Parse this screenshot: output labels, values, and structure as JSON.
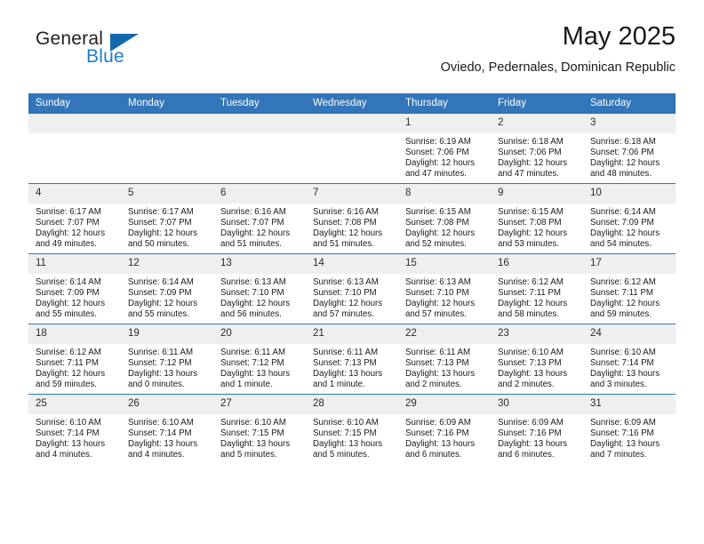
{
  "brand": {
    "name_part1": "General",
    "name_part2": "Blue",
    "logo_icon": "triangle-logo-icon"
  },
  "header": {
    "month_title": "May 2025",
    "location": "Oviedo, Pedernales, Dominican Republic"
  },
  "colors": {
    "header_blue": "#3275b8",
    "brand_blue": "#1b7fc4",
    "daynum_background": "#efefef",
    "text": "#1a1a1a"
  },
  "weekdays": [
    "Sunday",
    "Monday",
    "Tuesday",
    "Wednesday",
    "Thursday",
    "Friday",
    "Saturday"
  ],
  "weeks": [
    [
      {
        "day": "",
        "blank": true,
        "sunrise": "",
        "sunset": "",
        "daylight_line1": "",
        "daylight_line2": ""
      },
      {
        "day": "",
        "blank": true,
        "sunrise": "",
        "sunset": "",
        "daylight_line1": "",
        "daylight_line2": ""
      },
      {
        "day": "",
        "blank": true,
        "sunrise": "",
        "sunset": "",
        "daylight_line1": "",
        "daylight_line2": ""
      },
      {
        "day": "",
        "blank": true,
        "sunrise": "",
        "sunset": "",
        "daylight_line1": "",
        "daylight_line2": ""
      },
      {
        "day": "1",
        "blank": false,
        "sunrise": "Sunrise: 6:19 AM",
        "sunset": "Sunset: 7:06 PM",
        "daylight_line1": "Daylight: 12 hours",
        "daylight_line2": "and 47 minutes."
      },
      {
        "day": "2",
        "blank": false,
        "sunrise": "Sunrise: 6:18 AM",
        "sunset": "Sunset: 7:06 PM",
        "daylight_line1": "Daylight: 12 hours",
        "daylight_line2": "and 47 minutes."
      },
      {
        "day": "3",
        "blank": false,
        "sunrise": "Sunrise: 6:18 AM",
        "sunset": "Sunset: 7:06 PM",
        "daylight_line1": "Daylight: 12 hours",
        "daylight_line2": "and 48 minutes."
      }
    ],
    [
      {
        "day": "4",
        "blank": false,
        "sunrise": "Sunrise: 6:17 AM",
        "sunset": "Sunset: 7:07 PM",
        "daylight_line1": "Daylight: 12 hours",
        "daylight_line2": "and 49 minutes."
      },
      {
        "day": "5",
        "blank": false,
        "sunrise": "Sunrise: 6:17 AM",
        "sunset": "Sunset: 7:07 PM",
        "daylight_line1": "Daylight: 12 hours",
        "daylight_line2": "and 50 minutes."
      },
      {
        "day": "6",
        "blank": false,
        "sunrise": "Sunrise: 6:16 AM",
        "sunset": "Sunset: 7:07 PM",
        "daylight_line1": "Daylight: 12 hours",
        "daylight_line2": "and 51 minutes."
      },
      {
        "day": "7",
        "blank": false,
        "sunrise": "Sunrise: 6:16 AM",
        "sunset": "Sunset: 7:08 PM",
        "daylight_line1": "Daylight: 12 hours",
        "daylight_line2": "and 51 minutes."
      },
      {
        "day": "8",
        "blank": false,
        "sunrise": "Sunrise: 6:15 AM",
        "sunset": "Sunset: 7:08 PM",
        "daylight_line1": "Daylight: 12 hours",
        "daylight_line2": "and 52 minutes."
      },
      {
        "day": "9",
        "blank": false,
        "sunrise": "Sunrise: 6:15 AM",
        "sunset": "Sunset: 7:08 PM",
        "daylight_line1": "Daylight: 12 hours",
        "daylight_line2": "and 53 minutes."
      },
      {
        "day": "10",
        "blank": false,
        "sunrise": "Sunrise: 6:14 AM",
        "sunset": "Sunset: 7:09 PM",
        "daylight_line1": "Daylight: 12 hours",
        "daylight_line2": "and 54 minutes."
      }
    ],
    [
      {
        "day": "11",
        "blank": false,
        "sunrise": "Sunrise: 6:14 AM",
        "sunset": "Sunset: 7:09 PM",
        "daylight_line1": "Daylight: 12 hours",
        "daylight_line2": "and 55 minutes."
      },
      {
        "day": "12",
        "blank": false,
        "sunrise": "Sunrise: 6:14 AM",
        "sunset": "Sunset: 7:09 PM",
        "daylight_line1": "Daylight: 12 hours",
        "daylight_line2": "and 55 minutes."
      },
      {
        "day": "13",
        "blank": false,
        "sunrise": "Sunrise: 6:13 AM",
        "sunset": "Sunset: 7:10 PM",
        "daylight_line1": "Daylight: 12 hours",
        "daylight_line2": "and 56 minutes."
      },
      {
        "day": "14",
        "blank": false,
        "sunrise": "Sunrise: 6:13 AM",
        "sunset": "Sunset: 7:10 PM",
        "daylight_line1": "Daylight: 12 hours",
        "daylight_line2": "and 57 minutes."
      },
      {
        "day": "15",
        "blank": false,
        "sunrise": "Sunrise: 6:13 AM",
        "sunset": "Sunset: 7:10 PM",
        "daylight_line1": "Daylight: 12 hours",
        "daylight_line2": "and 57 minutes."
      },
      {
        "day": "16",
        "blank": false,
        "sunrise": "Sunrise: 6:12 AM",
        "sunset": "Sunset: 7:11 PM",
        "daylight_line1": "Daylight: 12 hours",
        "daylight_line2": "and 58 minutes."
      },
      {
        "day": "17",
        "blank": false,
        "sunrise": "Sunrise: 6:12 AM",
        "sunset": "Sunset: 7:11 PM",
        "daylight_line1": "Daylight: 12 hours",
        "daylight_line2": "and 59 minutes."
      }
    ],
    [
      {
        "day": "18",
        "blank": false,
        "sunrise": "Sunrise: 6:12 AM",
        "sunset": "Sunset: 7:11 PM",
        "daylight_line1": "Daylight: 12 hours",
        "daylight_line2": "and 59 minutes."
      },
      {
        "day": "19",
        "blank": false,
        "sunrise": "Sunrise: 6:11 AM",
        "sunset": "Sunset: 7:12 PM",
        "daylight_line1": "Daylight: 13 hours",
        "daylight_line2": "and 0 minutes."
      },
      {
        "day": "20",
        "blank": false,
        "sunrise": "Sunrise: 6:11 AM",
        "sunset": "Sunset: 7:12 PM",
        "daylight_line1": "Daylight: 13 hours",
        "daylight_line2": "and 1 minute."
      },
      {
        "day": "21",
        "blank": false,
        "sunrise": "Sunrise: 6:11 AM",
        "sunset": "Sunset: 7:13 PM",
        "daylight_line1": "Daylight: 13 hours",
        "daylight_line2": "and 1 minute."
      },
      {
        "day": "22",
        "blank": false,
        "sunrise": "Sunrise: 6:11 AM",
        "sunset": "Sunset: 7:13 PM",
        "daylight_line1": "Daylight: 13 hours",
        "daylight_line2": "and 2 minutes."
      },
      {
        "day": "23",
        "blank": false,
        "sunrise": "Sunrise: 6:10 AM",
        "sunset": "Sunset: 7:13 PM",
        "daylight_line1": "Daylight: 13 hours",
        "daylight_line2": "and 2 minutes."
      },
      {
        "day": "24",
        "blank": false,
        "sunrise": "Sunrise: 6:10 AM",
        "sunset": "Sunset: 7:14 PM",
        "daylight_line1": "Daylight: 13 hours",
        "daylight_line2": "and 3 minutes."
      }
    ],
    [
      {
        "day": "25",
        "blank": false,
        "sunrise": "Sunrise: 6:10 AM",
        "sunset": "Sunset: 7:14 PM",
        "daylight_line1": "Daylight: 13 hours",
        "daylight_line2": "and 4 minutes."
      },
      {
        "day": "26",
        "blank": false,
        "sunrise": "Sunrise: 6:10 AM",
        "sunset": "Sunset: 7:14 PM",
        "daylight_line1": "Daylight: 13 hours",
        "daylight_line2": "and 4 minutes."
      },
      {
        "day": "27",
        "blank": false,
        "sunrise": "Sunrise: 6:10 AM",
        "sunset": "Sunset: 7:15 PM",
        "daylight_line1": "Daylight: 13 hours",
        "daylight_line2": "and 5 minutes."
      },
      {
        "day": "28",
        "blank": false,
        "sunrise": "Sunrise: 6:10 AM",
        "sunset": "Sunset: 7:15 PM",
        "daylight_line1": "Daylight: 13 hours",
        "daylight_line2": "and 5 minutes."
      },
      {
        "day": "29",
        "blank": false,
        "sunrise": "Sunrise: 6:09 AM",
        "sunset": "Sunset: 7:16 PM",
        "daylight_line1": "Daylight: 13 hours",
        "daylight_line2": "and 6 minutes."
      },
      {
        "day": "30",
        "blank": false,
        "sunrise": "Sunrise: 6:09 AM",
        "sunset": "Sunset: 7:16 PM",
        "daylight_line1": "Daylight: 13 hours",
        "daylight_line2": "and 6 minutes."
      },
      {
        "day": "31",
        "blank": false,
        "sunrise": "Sunrise: 6:09 AM",
        "sunset": "Sunset: 7:16 PM",
        "daylight_line1": "Daylight: 13 hours",
        "daylight_line2": "and 7 minutes."
      }
    ]
  ]
}
